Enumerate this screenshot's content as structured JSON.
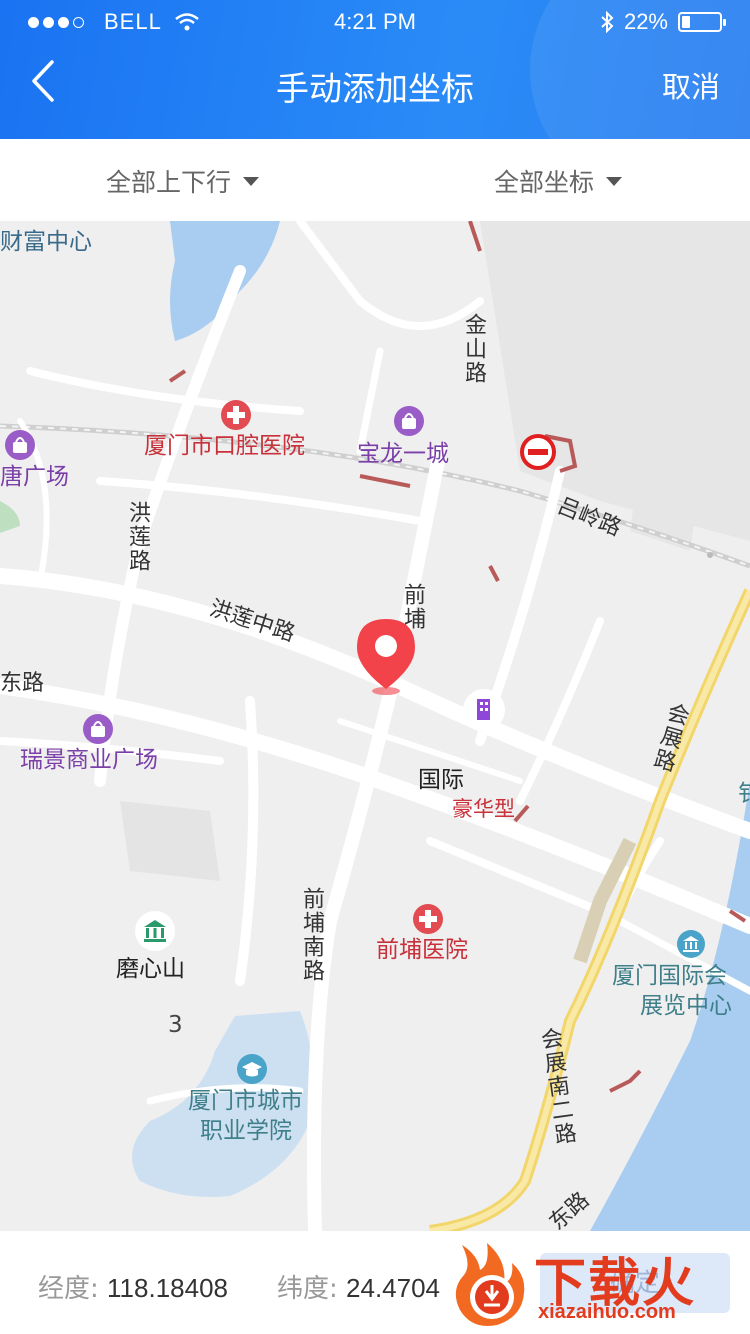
{
  "status_bar": {
    "carrier": "BELL",
    "time": "4:21 PM",
    "battery": "22%"
  },
  "nav": {
    "title": "手动添加坐标",
    "cancel_label": "取消"
  },
  "filters": {
    "direction": "全部上下行",
    "coordinates": "全部坐标"
  },
  "map": {
    "pois": [
      "财富中心",
      "厦门市口腔医院",
      "宝龙一城",
      "唐广场",
      "瑞景商业广场",
      "国际",
      "豪华型",
      "前埔医院",
      "磨心山",
      "3",
      "厦门国际会",
      "展览中心",
      "厦门市城市",
      "职业学院",
      "钅"
    ],
    "roads": [
      "金山路",
      "吕岭路",
      "洪莲路",
      "洪莲中路",
      "前埔",
      "会展路",
      "前埔南路",
      "会展南二路",
      "东路",
      "东路"
    ]
  },
  "coords": {
    "lng_label": "经度:",
    "lng_value": "118.18408",
    "lat_label": "纬度:",
    "lat_value": "24.4704"
  },
  "confirm": {
    "label": "确定"
  },
  "watermark": {
    "text": "下载火",
    "url": "xiazaihuo.com"
  },
  "colors": {
    "header": "#1a73f2",
    "poi_red": "#c8303a",
    "poi_purple": "#7b3fa8",
    "pin": "#f2434b",
    "water": "#a8cdf0"
  }
}
